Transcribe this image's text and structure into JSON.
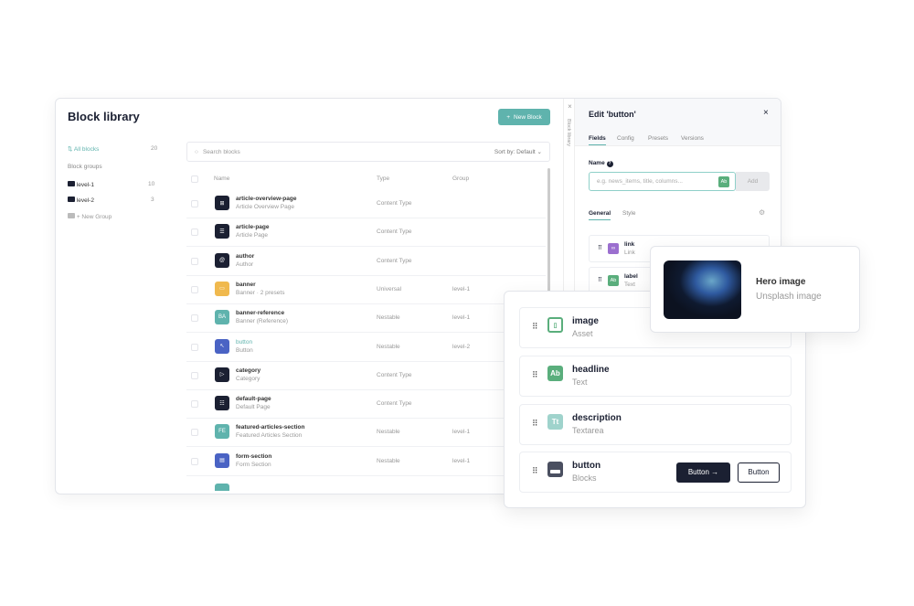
{
  "library": {
    "title": "Block library",
    "new_block": "New Block",
    "all_blocks": "All blocks",
    "all_count": "20",
    "groups_label": "Block groups",
    "groups": [
      {
        "name": "level-1",
        "count": "10"
      },
      {
        "name": "level-2",
        "count": "3"
      }
    ],
    "new_group": "+ New Group",
    "search_placeholder": "Search blocks",
    "sort": "Sort by: Default",
    "columns": [
      "Name",
      "Type",
      "Group"
    ],
    "rows": [
      {
        "name": "article-overview-page",
        "sub": "Article Overview Page",
        "type": "Content Type",
        "group": "",
        "icon": "layout-icon",
        "color": "#1b2032"
      },
      {
        "name": "article-page",
        "sub": "Article Page",
        "type": "Content Type",
        "group": "",
        "icon": "article-icon",
        "color": "#1b2032"
      },
      {
        "name": "author",
        "sub": "Author",
        "type": "Content Type",
        "group": "",
        "icon": "at-icon",
        "color": "#1b2032"
      },
      {
        "name": "banner",
        "sub": "Banner  ·  2 presets",
        "type": "Universal",
        "group": "level-1",
        "icon": "banner-icon",
        "color": "#f0b94e"
      },
      {
        "name": "banner-reference",
        "sub": "Banner (Reference)",
        "type": "Nestable",
        "group": "level-1",
        "icon": "BA",
        "color": "#5fb3ad"
      },
      {
        "name": "button",
        "sub": "Button",
        "type": "Nestable",
        "group": "level-2",
        "icon": "cursor-icon",
        "color": "#4a63c4"
      },
      {
        "name": "category",
        "sub": "Category",
        "type": "Content Type",
        "group": "",
        "icon": "tag-icon",
        "color": "#1b2032"
      },
      {
        "name": "default-page",
        "sub": "Default Page",
        "type": "Content Type",
        "group": "",
        "icon": "page-icon",
        "color": "#1b2032"
      },
      {
        "name": "featured-articles-section",
        "sub": "Featured Articles Section",
        "type": "Nestable",
        "group": "level-1",
        "icon": "FE",
        "color": "#5fb3ad"
      },
      {
        "name": "form-section",
        "sub": "Form Section",
        "type": "Nestable",
        "group": "level-1",
        "icon": "form-icon",
        "color": "#4a63c4"
      }
    ],
    "strip_label": "Block library"
  },
  "edit": {
    "title": "Edit 'button'",
    "tabs": [
      "Fields",
      "Config",
      "Presets",
      "Versions"
    ],
    "name_label": "Name",
    "name_placeholder": "e.g. news_items, title, columns...",
    "type_badge": "Ab",
    "add": "Add",
    "subtabs": [
      "General",
      "Style"
    ],
    "fields": [
      {
        "name": "link",
        "type": "Link",
        "badge": "link-icon",
        "color": "#9b6fcf"
      },
      {
        "name": "label",
        "type": "Text",
        "badge": "Ab",
        "color": "#5aae7c"
      }
    ]
  },
  "hero": {
    "title": "Hero image",
    "sub": "Unsplash image"
  },
  "card": {
    "fields": [
      {
        "name": "image",
        "type": "Asset",
        "badge": "image-icon",
        "color": "#5aae7c"
      },
      {
        "name": "headline",
        "type": "Text",
        "badge": "Ab",
        "color": "#5aae7c"
      },
      {
        "name": "description",
        "type": "Textarea",
        "badge": "Tt",
        "color": "#9fd3cc"
      },
      {
        "name": "button",
        "type": "Blocks",
        "badge": "blocks-icon",
        "color": "#4a4f60"
      }
    ],
    "btn_primary": "Button →",
    "btn_secondary": "Button"
  }
}
